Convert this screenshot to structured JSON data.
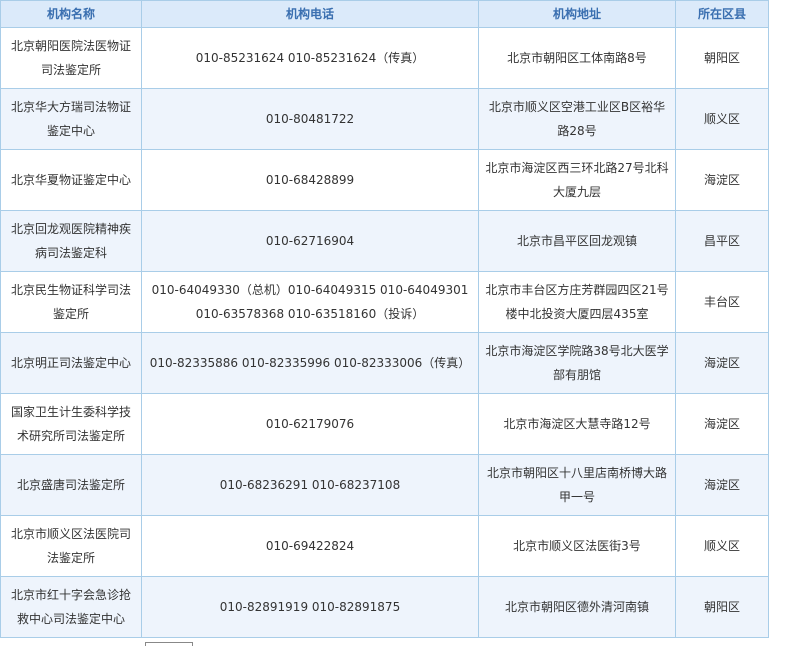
{
  "columns": [
    "机构名称",
    "机构电话",
    "机构地址",
    "所在区县"
  ],
  "rows": [
    {
      "name": "北京朝阳医院法医物证司法鉴定所",
      "phone": "010-85231624 010-85231624（传真）",
      "address": "北京市朝阳区工体南路8号",
      "district": "朝阳区"
    },
    {
      "name": "北京华大方瑞司法物证鉴定中心",
      "phone": "010-80481722",
      "address": "北京市顺义区空港工业区B区裕华路28号",
      "district": "顺义区"
    },
    {
      "name": "北京华夏物证鉴定中心",
      "phone": "010-68428899",
      "address": "北京市海淀区西三环北路27号北科大厦九层",
      "district": "海淀区"
    },
    {
      "name": "北京回龙观医院精神疾病司法鉴定科",
      "phone": "010-62716904",
      "address": "北京市昌平区回龙观镇",
      "district": "昌平区"
    },
    {
      "name": "北京民生物证科学司法鉴定所",
      "phone": "010-64049330（总机）010-64049315 010-64049301 010-63578368 010-63518160（投诉）",
      "address": "北京市丰台区方庄芳群园四区21号楼中北投资大厦四层435室",
      "district": "丰台区"
    },
    {
      "name": "北京明正司法鉴定中心",
      "phone": "010-82335886 010-82335996 010-82333006（传真）",
      "address": "北京市海淀区学院路38号北大医学部有朋馆",
      "district": "海淀区"
    },
    {
      "name": "国家卫生计生委科学技术研究所司法鉴定所",
      "phone": "010-62179076",
      "address": "北京市海淀区大慧寺路12号",
      "district": "海淀区"
    },
    {
      "name": "北京盛唐司法鉴定所",
      "phone": "010-68236291 010-68237108",
      "address": "北京市朝阳区十八里店南桥博大路甲一号",
      "district": "海淀区"
    },
    {
      "name": "北京市顺义区法医院司法鉴定所",
      "phone": "010-69422824",
      "address": "北京市顺义区法医街3号",
      "district": "顺义区"
    },
    {
      "name": "北京市红十字会急诊抢救中心司法鉴定中心",
      "phone": "010-82891919 010-82891875",
      "address": "北京市朝阳区德外清河南镇",
      "district": "朝阳区"
    }
  ]
}
